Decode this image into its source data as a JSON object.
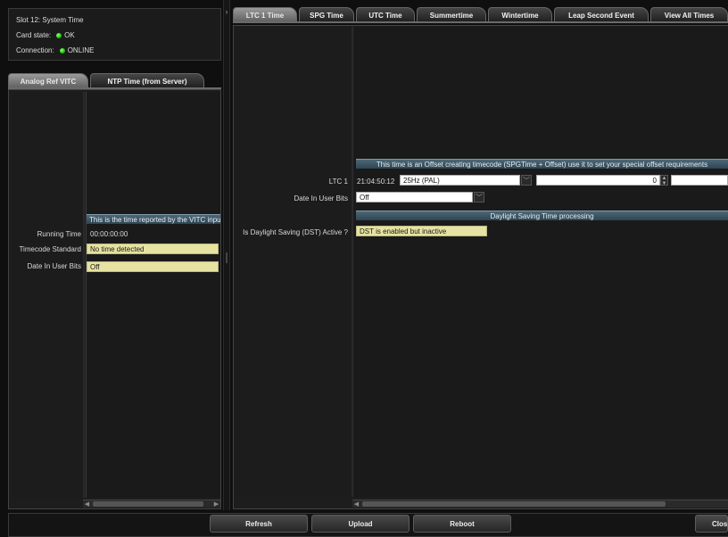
{
  "status": {
    "slot_title": "Slot 12: System Time",
    "card_state_label": "Card state:",
    "card_state_value": "OK",
    "connection_label": "Connection:",
    "connection_value": "ONLINE",
    "led_color": "#17c400"
  },
  "left_tabs": [
    {
      "label": "Analog Ref VITC",
      "active": true
    },
    {
      "label": "NTP Time (from Server)",
      "active": false
    }
  ],
  "left_panel": {
    "info_header": "This is the time reported by the VITC input",
    "running_time_label": "Running Time",
    "running_time_value": "00:00:00:00",
    "timecode_standard_label": "Timecode Standard",
    "timecode_standard_value": "No time detected",
    "date_user_bits_label": "Date In User Bits",
    "date_user_bits_value": "Off"
  },
  "right_tabs": [
    {
      "label": "LTC 1 Time",
      "active": true
    },
    {
      "label": "SPG Time",
      "active": false
    },
    {
      "label": "UTC Time",
      "active": false
    },
    {
      "label": "Summertime",
      "active": false
    },
    {
      "label": "Wintertime",
      "active": false
    },
    {
      "label": "Leap Second Event",
      "active": false
    },
    {
      "label": "View All Times",
      "active": false
    }
  ],
  "right_panel": {
    "offset_header": "This time is an Offset creating timecode (SPGTime + Offset) use it to set your special offset requirements",
    "ltc_label": "LTC 1",
    "ltc_time": "21:04:50:12",
    "ltc_rate": "25Hz (PAL)",
    "ltc_offset": "0",
    "date_user_bits_label": "Date In User Bits",
    "date_user_bits_value": "Off",
    "dst_header": "Daylight Saving Time processing",
    "dst_label": "Is Daylight Saving (DST) Active ?",
    "dst_value": "DST is enabled but inactive"
  },
  "buttons": {
    "refresh": "Refresh",
    "upload": "Upload",
    "reboot": "Reboot",
    "close": "Close"
  },
  "icons": {
    "splitter_arrow": "chevron-right-icon",
    "dropdown": "chevron-down-icon",
    "spin": "spin-updown-icon",
    "scroll_left": "scroll-left-icon",
    "scroll_right": "scroll-right-icon"
  }
}
